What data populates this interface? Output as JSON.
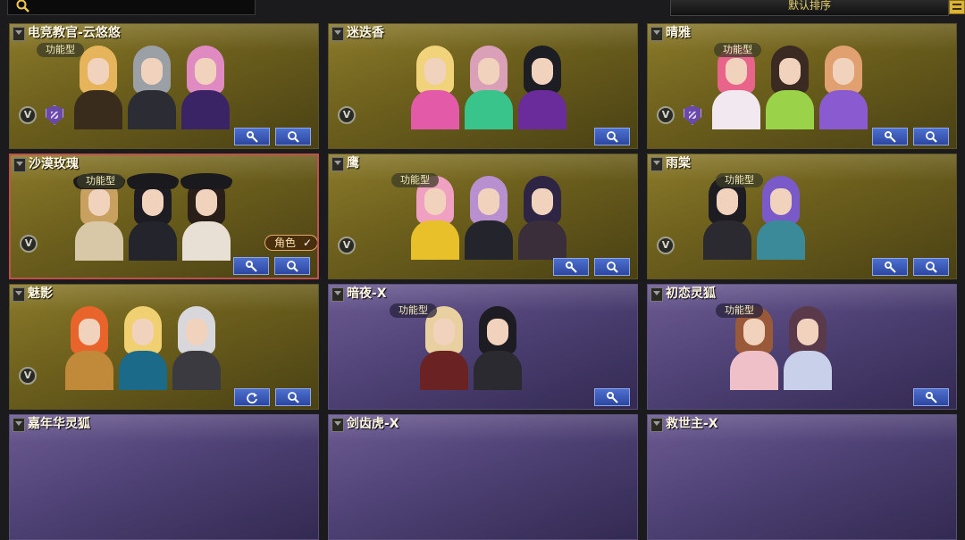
{
  "search": {
    "placeholder": ""
  },
  "sort": {
    "label": "默认排序"
  },
  "cards": [
    {
      "name": "电竞教官-云悠悠",
      "type": "功能型",
      "theme": "gold",
      "badges": [
        "v",
        "shield"
      ],
      "buttons": [
        "settings",
        "search"
      ]
    },
    {
      "name": "迷迭香",
      "type": "",
      "theme": "gold",
      "badges": [
        "v"
      ],
      "buttons": [
        "search"
      ]
    },
    {
      "name": "晴雅",
      "type": "功能型",
      "theme": "gold",
      "badges": [
        "v",
        "shield"
      ],
      "buttons": [
        "settings",
        "search"
      ]
    },
    {
      "name": "沙漠玫瑰",
      "type": "功能型",
      "theme": "gold",
      "selected": true,
      "role_tag": "角色",
      "badges": [
        "v"
      ],
      "buttons": [
        "settings",
        "search"
      ]
    },
    {
      "name": "鹰",
      "type": "功能型",
      "theme": "gold",
      "badges": [
        "v"
      ],
      "buttons": [
        "settings",
        "search"
      ]
    },
    {
      "name": "雨棠",
      "type": "功能型",
      "theme": "gold",
      "badges": [
        "v"
      ],
      "buttons": [
        "settings",
        "search"
      ]
    },
    {
      "name": "魅影",
      "type": "",
      "theme": "gold",
      "badges": [
        "v"
      ],
      "buttons": [
        "refresh",
        "search"
      ]
    },
    {
      "name": "暗夜-X",
      "type": "功能型",
      "theme": "purple",
      "badges": [],
      "buttons": [
        "settings"
      ]
    },
    {
      "name": "初恋灵狐",
      "type": "功能型",
      "theme": "purple",
      "badges": [],
      "buttons": [
        "settings"
      ]
    },
    {
      "name": "嘉年华灵狐",
      "type": "",
      "theme": "purple",
      "badges": [],
      "buttons": []
    },
    {
      "name": "剑齿虎-X",
      "type": "",
      "theme": "purple",
      "badges": [],
      "buttons": []
    },
    {
      "name": "救世主-X",
      "type": "",
      "theme": "purple",
      "badges": [],
      "buttons": []
    }
  ],
  "colors": {
    "gold_card": "#7a6b22",
    "purple_card": "#4c3f72",
    "button_blue": "#3a5bc0",
    "selected_border": "#c0504a",
    "accent_text": "#e6cf6a"
  }
}
